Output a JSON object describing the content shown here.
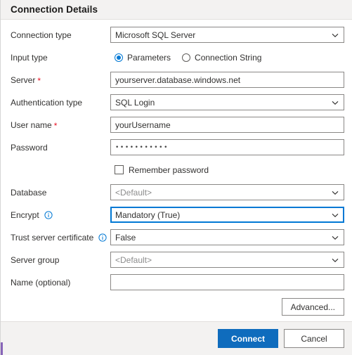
{
  "header": {
    "title": "Connection Details"
  },
  "form": {
    "connection_type": {
      "label": "Connection type",
      "value": "Microsoft SQL Server",
      "chevron": "chevron-down-icon"
    },
    "input_type": {
      "label": "Input type",
      "options": [
        {
          "label": "Parameters",
          "selected": true
        },
        {
          "label": "Connection String",
          "selected": false
        }
      ]
    },
    "server": {
      "label": "Server",
      "required": "*",
      "value": "yourserver.database.windows.net"
    },
    "authentication_type": {
      "label": "Authentication type",
      "value": "SQL Login",
      "chevron": "chevron-down-icon"
    },
    "user_name": {
      "label": "User name",
      "required": "*",
      "value": "yourUsername"
    },
    "password": {
      "label": "Password",
      "value": "•••••••••••"
    },
    "remember_password": {
      "label": "Remember password",
      "checked": false
    },
    "database": {
      "label": "Database",
      "value": "<Default>",
      "is_placeholder": true,
      "chevron": "chevron-down-icon"
    },
    "encrypt": {
      "label": "Encrypt",
      "info": "info-icon",
      "value": "Mandatory (True)",
      "focused": true,
      "chevron": "chevron-down-icon"
    },
    "trust_server_certificate": {
      "label": "Trust server certificate",
      "info": "info-icon",
      "value": "False",
      "chevron": "chevron-down-icon"
    },
    "server_group": {
      "label": "Server group",
      "value": "<Default>",
      "is_placeholder": true,
      "chevron": "chevron-down-icon"
    },
    "name_optional": {
      "label": "Name (optional)",
      "value": ""
    },
    "advanced_button": "Advanced..."
  },
  "footer": {
    "connect_label": "Connect",
    "cancel_label": "Cancel"
  },
  "colors": {
    "accent_blue": "#0078d4",
    "primary_button": "#0f6cbd",
    "required_red": "#e81123",
    "header_bg": "#f3f2f1",
    "bottom_accent": "#8764b8"
  }
}
